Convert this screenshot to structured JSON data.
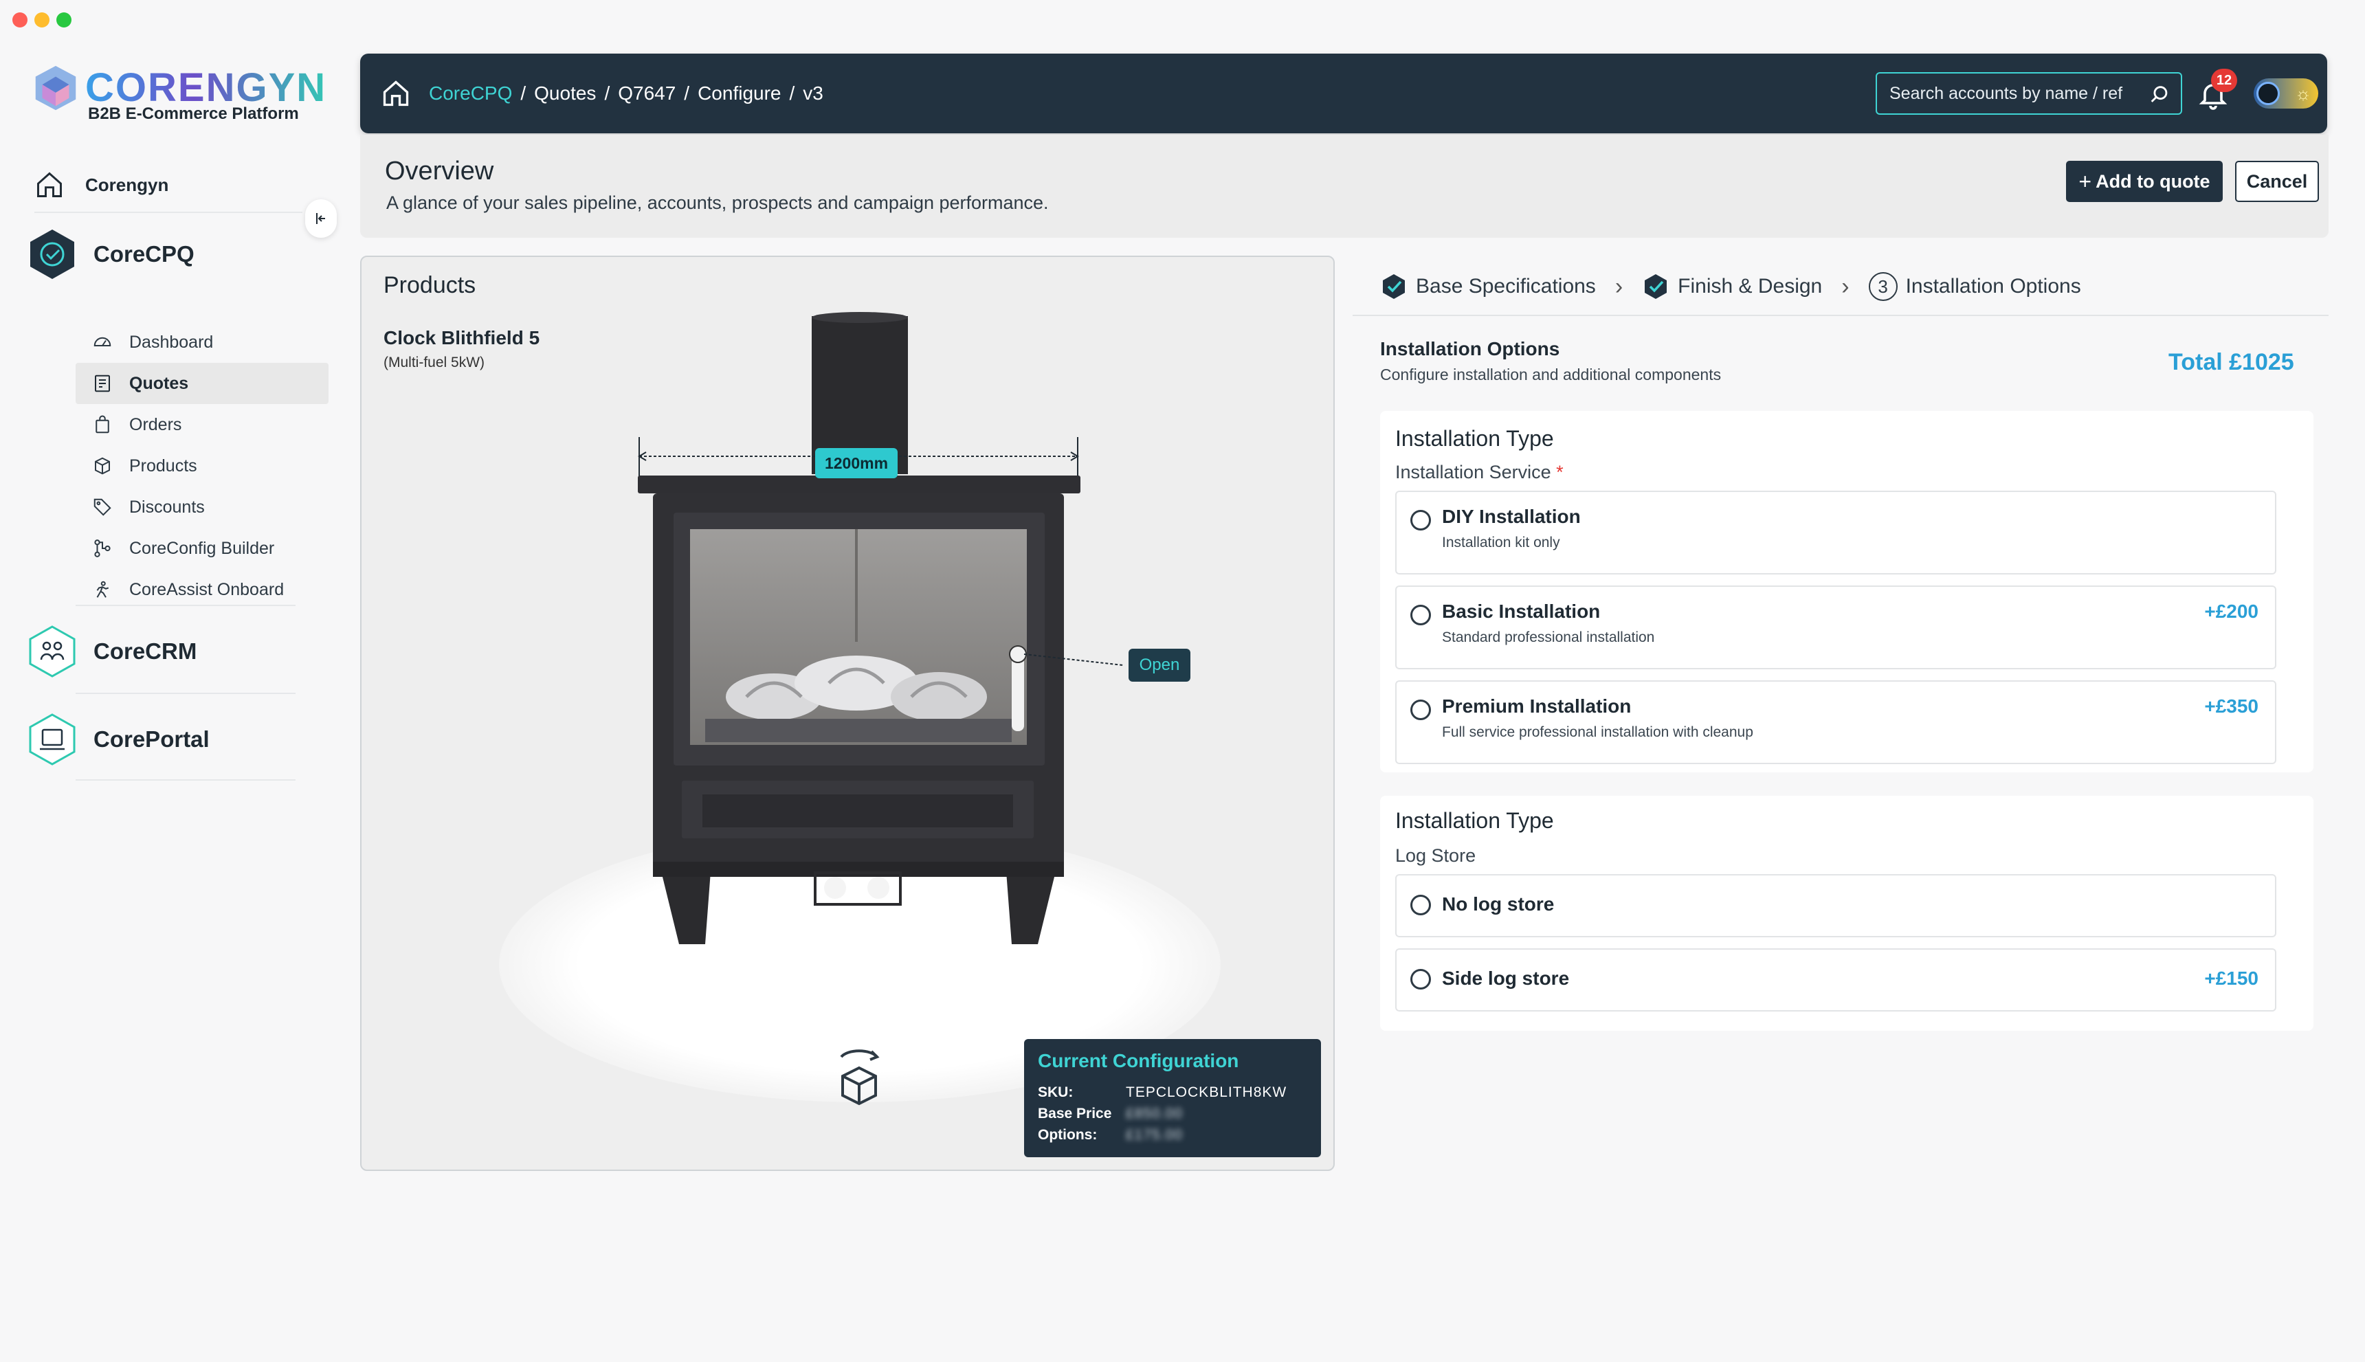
{
  "sidebar": {
    "logo_word": "CORENGYN",
    "logo_sub": "B2B E-Commerce Platform",
    "home_label": "Corengyn",
    "products": [
      {
        "label": "CoreCPQ",
        "color": "#223240"
      },
      {
        "label": "CoreCRM",
        "color": "#2ec9b0"
      },
      {
        "label": "CorePortal",
        "color": "#2ec9b0"
      }
    ],
    "cpq_items": [
      {
        "label": "Dashboard",
        "icon": "dashboard-icon"
      },
      {
        "label": "Quotes",
        "icon": "quotes-icon",
        "active": true
      },
      {
        "label": "Orders",
        "icon": "orders-icon"
      },
      {
        "label": "Products",
        "icon": "products-icon"
      },
      {
        "label": "Discounts",
        "icon": "discounts-icon"
      },
      {
        "label": "CoreConfig Builder",
        "icon": "config-builder-icon"
      },
      {
        "label": "CoreAssist Onboard",
        "icon": "assist-onboard-icon"
      }
    ]
  },
  "header": {
    "breadcrumb": [
      "CoreCPQ",
      "/",
      "Quotes",
      "/",
      "Q7647",
      "/",
      "Configure",
      "/",
      "v3"
    ],
    "search_placeholder": "Search accounts by name / ref",
    "notification_count": "12"
  },
  "overview": {
    "title": "Overview",
    "subtitle": "A glance of your sales pipeline, accounts, prospects and campaign performance.",
    "add_label": "Add to quote",
    "cancel_label": "Cancel"
  },
  "products_panel": {
    "title": "Products",
    "product_name": "Clock Blithfield 5",
    "product_spec": "(Multi-fuel 5kW)",
    "dimension_label": "1200mm",
    "open_label": "Open",
    "config": {
      "title": "Current Configuration",
      "sku_label": "SKU:",
      "sku_value": "TEPCLOCKBLITH8KW",
      "base_label": "Base Price",
      "base_value": "£850.00",
      "options_label": "Options:",
      "options_value": "£175.00"
    }
  },
  "stepper": {
    "steps": [
      {
        "label": "Base Specifications",
        "state": "done"
      },
      {
        "label": "Finish & Design",
        "state": "done"
      },
      {
        "label": "Installation Options",
        "state": "current",
        "number": "3"
      }
    ]
  },
  "installation": {
    "title": "Installation Options",
    "subtitle": "Configure installation and additional components",
    "total": "Total £1025",
    "sections": [
      {
        "title": "Installation Type",
        "label": "Installation Service",
        "required": "*",
        "options": [
          {
            "title": "DIY Installation",
            "desc": "Installation kit only",
            "price": ""
          },
          {
            "title": "Basic Installation",
            "desc": "Standard professional installation",
            "price": "+£200"
          },
          {
            "title": "Premium Installation",
            "desc": "Full service professional installation with cleanup",
            "price": "+£350"
          }
        ]
      },
      {
        "title": "Installation Type",
        "label": "Log Store",
        "options": [
          {
            "title": "No log store",
            "price": ""
          },
          {
            "title": "Side log store",
            "price": "+£150"
          }
        ]
      }
    ]
  },
  "colors": {
    "navy": "#223240",
    "accent_teal": "#3fd4d4",
    "price_blue": "#2a9fd6"
  }
}
